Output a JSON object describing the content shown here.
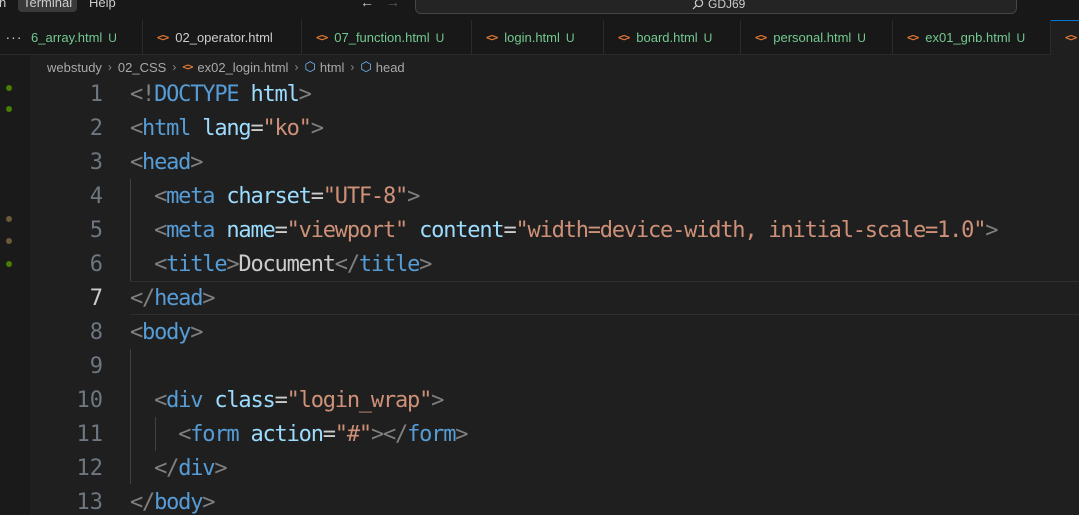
{
  "menu": {
    "items": [
      "n",
      "Terminal",
      "Help"
    ],
    "active_index": 1
  },
  "command_center": {
    "text": "GDJ69"
  },
  "tabs": [
    {
      "label": "6_array.html",
      "status": "U",
      "modified": true
    },
    {
      "label": "02_operator.html",
      "status": "",
      "modified": false
    },
    {
      "label": "07_function.html",
      "status": "U",
      "modified": true
    },
    {
      "label": "login.html",
      "status": "U",
      "modified": true
    },
    {
      "label": "board.html",
      "status": "U",
      "modified": true
    },
    {
      "label": "personal.html",
      "status": "U",
      "modified": true
    },
    {
      "label": "ex01_gnb.html",
      "status": "U",
      "modified": true
    },
    {
      "label": "",
      "status": "",
      "modified": false
    }
  ],
  "breadcrumb": {
    "segments": [
      "webstudy",
      "02_CSS",
      "ex02_login.html",
      "html",
      "head"
    ]
  },
  "editor": {
    "active_line": 7,
    "lines": [
      {
        "n": "1",
        "tokens": [
          [
            "p",
            "<!"
          ],
          [
            "tag",
            "DOCTYPE"
          ],
          [
            "txt",
            " "
          ],
          [
            "attr",
            "html"
          ],
          [
            "p",
            ">"
          ]
        ]
      },
      {
        "n": "2",
        "tokens": [
          [
            "p",
            "<"
          ],
          [
            "tag",
            "html"
          ],
          [
            "txt",
            " "
          ],
          [
            "attr",
            "lang"
          ],
          [
            "eq",
            "="
          ],
          [
            "str",
            "\"ko\""
          ],
          [
            "p",
            ">"
          ]
        ]
      },
      {
        "n": "3",
        "tokens": [
          [
            "p",
            "<"
          ],
          [
            "tag",
            "head"
          ],
          [
            "p",
            ">"
          ]
        ]
      },
      {
        "n": "4",
        "tokens": [
          [
            "txt",
            "  "
          ],
          [
            "p",
            "<"
          ],
          [
            "tag",
            "meta"
          ],
          [
            "txt",
            " "
          ],
          [
            "attr",
            "charset"
          ],
          [
            "eq",
            "="
          ],
          [
            "str",
            "\"UTF-8\""
          ],
          [
            "p",
            ">"
          ]
        ]
      },
      {
        "n": "5",
        "tokens": [
          [
            "txt",
            "  "
          ],
          [
            "p",
            "<"
          ],
          [
            "tag",
            "meta"
          ],
          [
            "txt",
            " "
          ],
          [
            "attr",
            "name"
          ],
          [
            "eq",
            "="
          ],
          [
            "str",
            "\"viewport\""
          ],
          [
            "txt",
            " "
          ],
          [
            "attr",
            "content"
          ],
          [
            "eq",
            "="
          ],
          [
            "str",
            "\"width=device-width, initial-scale=1.0\""
          ],
          [
            "p",
            ">"
          ]
        ]
      },
      {
        "n": "6",
        "tokens": [
          [
            "txt",
            "  "
          ],
          [
            "p",
            "<"
          ],
          [
            "tag",
            "title"
          ],
          [
            "p",
            ">"
          ],
          [
            "txt",
            "Document"
          ],
          [
            "p",
            "</"
          ],
          [
            "tag",
            "title"
          ],
          [
            "p",
            ">"
          ]
        ]
      },
      {
        "n": "7",
        "tokens": [
          [
            "p",
            "</"
          ],
          [
            "tag",
            "head"
          ],
          [
            "p",
            ">"
          ]
        ]
      },
      {
        "n": "8",
        "tokens": [
          [
            "p",
            "<"
          ],
          [
            "tag",
            "body"
          ],
          [
            "p",
            ">"
          ]
        ]
      },
      {
        "n": "9",
        "tokens": []
      },
      {
        "n": "10",
        "tokens": [
          [
            "txt",
            "  "
          ],
          [
            "p",
            "<"
          ],
          [
            "tag",
            "div"
          ],
          [
            "txt",
            " "
          ],
          [
            "attr",
            "class"
          ],
          [
            "eq",
            "="
          ],
          [
            "str",
            "\"login_wrap\""
          ],
          [
            "p",
            ">"
          ]
        ]
      },
      {
        "n": "11",
        "tokens": [
          [
            "txt",
            "    "
          ],
          [
            "p",
            "<"
          ],
          [
            "tag",
            "form"
          ],
          [
            "txt",
            " "
          ],
          [
            "attr",
            "action"
          ],
          [
            "eq",
            "="
          ],
          [
            "str",
            "\"#\""
          ],
          [
            "p",
            "></"
          ],
          [
            "tag",
            "form"
          ],
          [
            "p",
            ">"
          ]
        ]
      },
      {
        "n": "12",
        "tokens": [
          [
            "txt",
            "  "
          ],
          [
            "p",
            "</"
          ],
          [
            "tag",
            "div"
          ],
          [
            "p",
            ">"
          ]
        ]
      },
      {
        "n": "13",
        "tokens": [
          [
            "p",
            "</"
          ],
          [
            "tag",
            "body"
          ],
          [
            "p",
            ">"
          ]
        ]
      }
    ]
  },
  "scm_gutter": [
    {
      "kind": "added",
      "color": "#487e02"
    },
    {
      "kind": "added",
      "color": "#487e02"
    },
    {
      "kind": "modified",
      "color": "#6b5a3a"
    },
    {
      "kind": "modified",
      "color": "#6b5a3a"
    },
    {
      "kind": "added",
      "color": "#487e02"
    }
  ],
  "colors": {
    "tag": "#569cd6",
    "attribute": "#9cdcfe",
    "string": "#ce9178",
    "punctuation": "#808080",
    "untracked": "#73c991",
    "html_icon": "#e37933",
    "accent": "#0078d4"
  },
  "icons": {
    "tab_file": "html-file-icon",
    "breadcrumb_symbol": "symbol-element-icon",
    "search": "search-icon",
    "back": "arrow-left-icon",
    "forward": "arrow-right-icon",
    "overflow": "more-icon"
  }
}
